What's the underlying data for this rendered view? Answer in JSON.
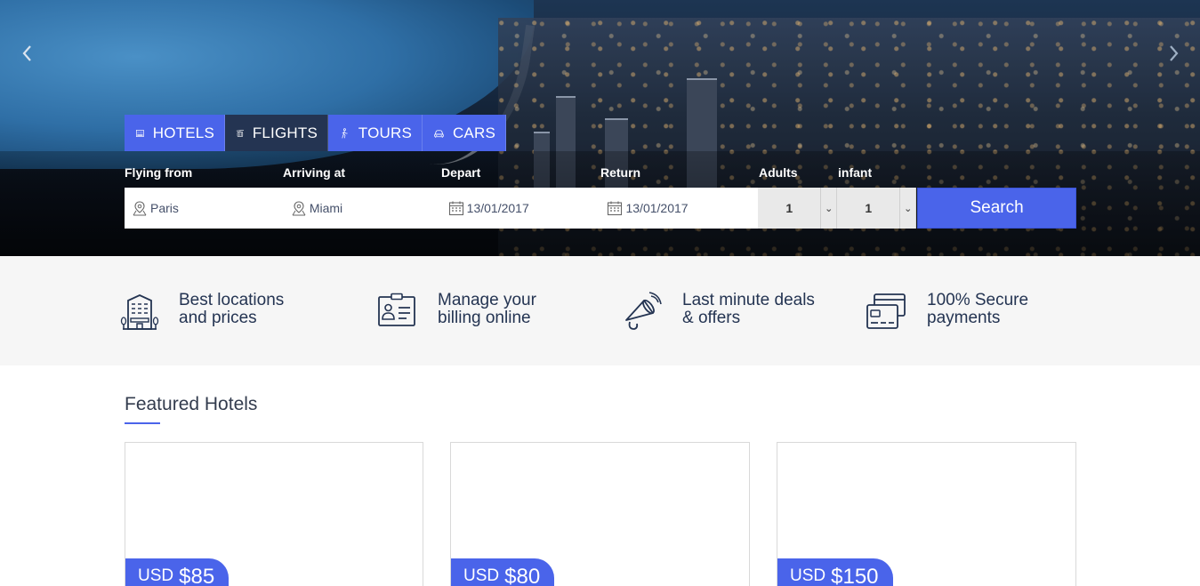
{
  "hero": {
    "prev_icon": "chevron-left-icon",
    "next_icon": "chevron-right-icon"
  },
  "tabs": [
    {
      "label": "HOTELS",
      "icon": "hotel-icon",
      "active": false
    },
    {
      "label": "FLIGHTS",
      "icon": "cable-car-icon",
      "active": true
    },
    {
      "label": "TOURS",
      "icon": "hiker-icon",
      "active": false
    },
    {
      "label": "CARS",
      "icon": "car-icon",
      "active": false
    }
  ],
  "search": {
    "flying_from_label": "Flying from",
    "arriving_at_label": "Arriving at",
    "depart_label": "Depart",
    "return_label": "Return",
    "adults_label": "Adults",
    "infant_label": "infant",
    "flying_from_value": "Paris",
    "arriving_at_value": "Miami",
    "depart_value": "13/01/2017",
    "return_value": "13/01/2017",
    "adults_value": "1",
    "infant_value": "1",
    "button_label": "Search"
  },
  "features": [
    {
      "line1": "Best locations",
      "line2": "and prices",
      "icon": "hotel-building-icon"
    },
    {
      "line1": "Manage your",
      "line2": "billing online",
      "icon": "id-card-icon"
    },
    {
      "line1": "Last minute deals",
      "line2": "& offers",
      "icon": "megaphone-icon"
    },
    {
      "line1": "100% Secure",
      "line2": "payments",
      "icon": "credit-cards-icon"
    }
  ],
  "featured": {
    "title": "Featured Hotels",
    "hotels": [
      {
        "currency": "USD",
        "price": "$85"
      },
      {
        "currency": "USD",
        "price": "$80"
      },
      {
        "currency": "USD",
        "price": "$150"
      }
    ]
  },
  "colors": {
    "accent": "#4a64ea",
    "tab_active": "#243452",
    "text_dark": "#243452",
    "features_bg": "#f6f6f6"
  }
}
